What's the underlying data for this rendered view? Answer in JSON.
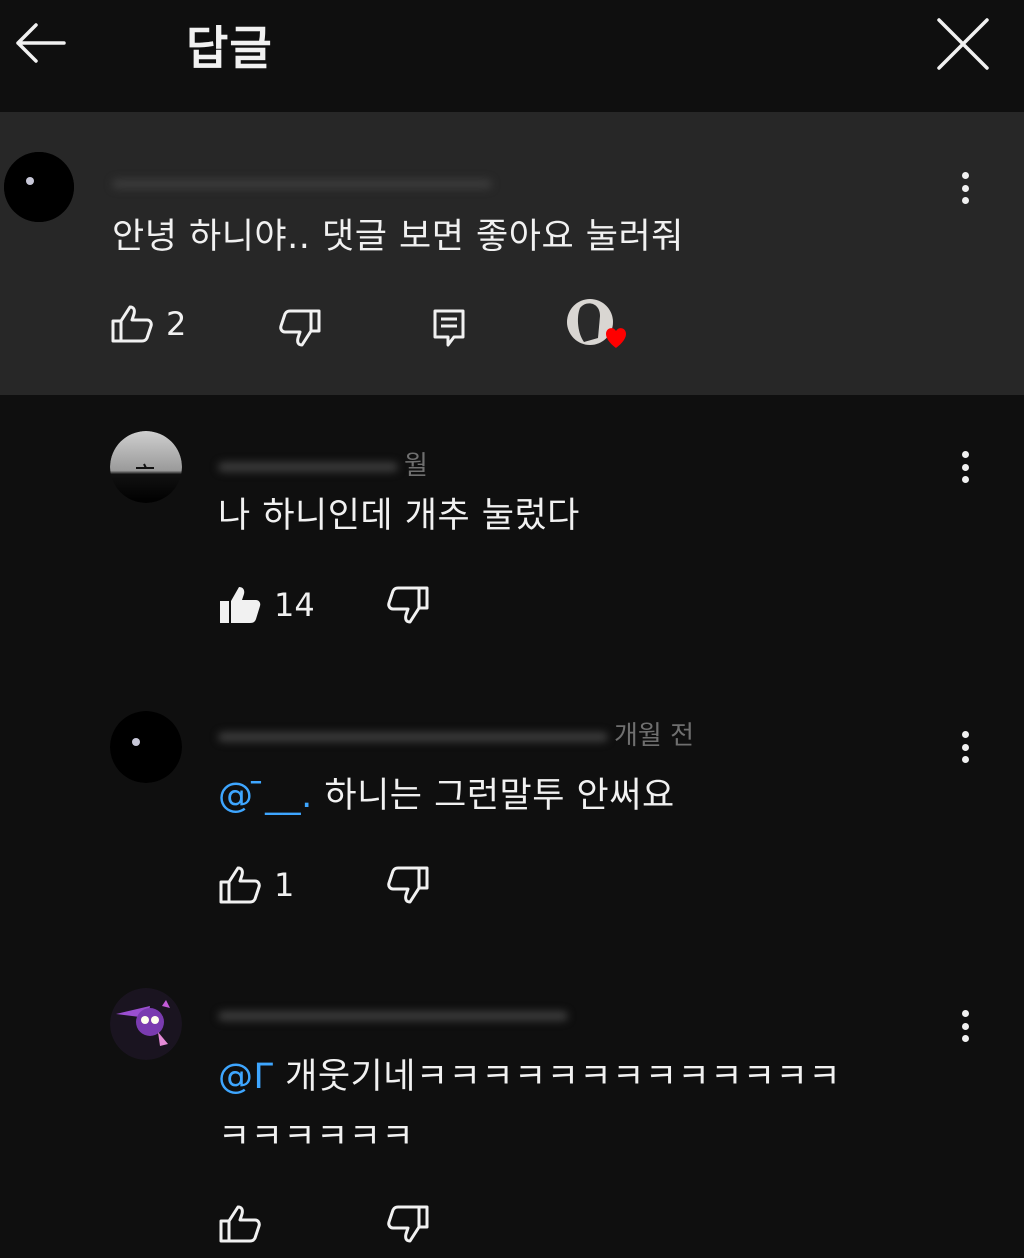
{
  "header": {
    "title": "답글",
    "back_icon": "arrow-left-icon",
    "close_icon": "close-icon"
  },
  "parent_comment": {
    "text": "안녕 하니야.. 댓글 보면 좋아요 눌러줘",
    "likes": "2",
    "creator_heart": true
  },
  "replies": [
    {
      "author_suffix": "월 ",
      "text": "나 하니인데 개추 눌렀다",
      "likes": "14",
      "liked": true
    },
    {
      "author_suffix": "개월 전",
      "mention": "@ ̄__.",
      "text": " 하니는 그런말투 안써요",
      "likes": "1",
      "liked": false
    },
    {
      "author_suffix": "",
      "mention": "@Γ",
      "text_line1": " 개웃기네ㅋㅋㅋㅋㅋㅋㅋㅋㅋㅋㅋㅋㅋ",
      "text_line2": "ㅋㅋㅋㅋㅋㅋ",
      "likes": "",
      "liked": false
    }
  ],
  "colors": {
    "background": "#0f0f0f",
    "highlight": "#272727",
    "text": "#f1f1f1",
    "mention": "#3ea6ff",
    "heart": "#ff0000"
  }
}
